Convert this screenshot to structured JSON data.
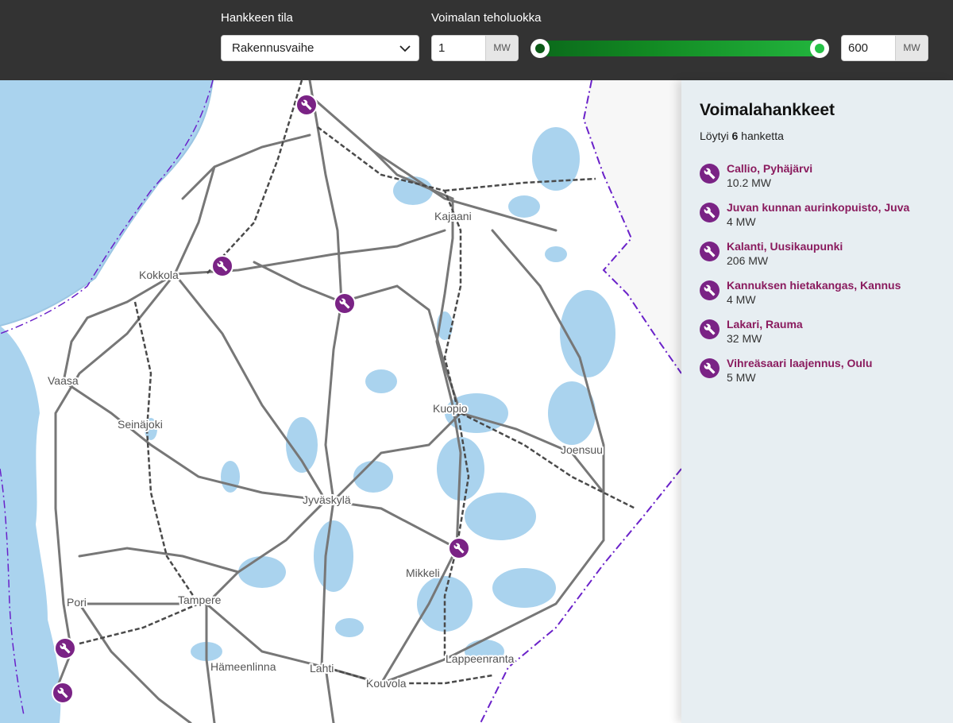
{
  "filters": {
    "status_label": "Hankkeen tila",
    "status_value": "Rakennusvaihe",
    "power_label": "Voimalan teholuokka",
    "min_value": "1",
    "max_value": "600",
    "unit": "MW",
    "range_fraction": [
      0.0,
      1.0
    ],
    "slider_color": "#1faa39"
  },
  "map": {
    "cities": [
      "Kajaani",
      "Kokkola",
      "Vaasa",
      "Seinäjoki",
      "Kuopio",
      "Joensuu",
      "Jyväskylä",
      "Mikkeli",
      "Pori",
      "Tampere",
      "Hämeenlinna",
      "Lahti",
      "Kouvola",
      "Lappeenranta"
    ],
    "marker_icon": "wrench-icon",
    "marker_color": "#7a2385",
    "water_color": "#aad3ee",
    "border_color": "#6a21c9"
  },
  "panel": {
    "title": "Voimalahankkeet",
    "found_prefix": "Löytyi",
    "found_count": "6",
    "found_suffix": "hanketta",
    "projects": [
      {
        "name": "Callio, Pyhäjärvi",
        "power": "10.2 MW"
      },
      {
        "name": "Juvan kunnan aurinkopuisto, Juva",
        "power": "4 MW"
      },
      {
        "name": "Kalanti, Uusikaupunki",
        "power": "206 MW"
      },
      {
        "name": "Kannuksen hietakangas, Kannus",
        "power": "4 MW"
      },
      {
        "name": "Lakari, Rauma",
        "power": "32 MW"
      },
      {
        "name": "Vihreäsaari laajennus, Oulu",
        "power": "5 MW"
      }
    ]
  }
}
